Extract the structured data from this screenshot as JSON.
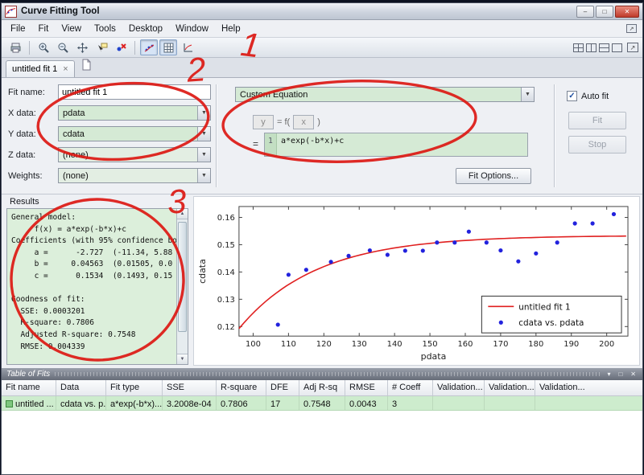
{
  "titlebar": {
    "title": "Curve Fitting Tool"
  },
  "menubar": {
    "items": [
      "File",
      "Fit",
      "View",
      "Tools",
      "Desktop",
      "Window",
      "Help"
    ]
  },
  "tabbar": {
    "tab_label": "untitled fit 1"
  },
  "icons": {
    "minimize": "–",
    "maximize": "□",
    "close": "✕",
    "combo_arrow": "▼",
    "tab_close": "×",
    "check": "✓",
    "scroll_up": "▲",
    "scroll_down": "▼",
    "undock_arrow": "↗",
    "tof_collapse": "▾",
    "tof_restore": "□",
    "tof_close": "✕"
  },
  "fit_panel": {
    "fit_name_label": "Fit name:",
    "fit_name_value": "untitled fit 1",
    "x_label": "X data:",
    "x_value": "pdata",
    "y_label": "Y data:",
    "y_value": "cdata",
    "z_label": "Z data:",
    "z_value": "(none)",
    "w_label": "Weights:",
    "w_value": "(none)"
  },
  "equation_panel": {
    "type_value": "Custom Equation",
    "y_box": "y",
    "equals_f": "=  f(",
    "x_box": "x",
    "close_paren": ")",
    "equals": "=",
    "line_no": "1",
    "equation": "a*exp(-b*x)+c",
    "fit_options_label": "Fit Options..."
  },
  "controls": {
    "auto_fit": "Auto fit",
    "fit": "Fit",
    "stop": "Stop"
  },
  "results": {
    "title": "Results",
    "text": [
      "General model:",
      "     f(x) = a*exp(-b*x)+c",
      "Coefficients (with 95% confidence bou",
      "     a =      -2.727  (-11.34, 5.88",
      "     b =     0.04563  (0.01505, 0.0",
      "     c =      0.1534  (0.1493, 0.15",
      "",
      "Goodness of fit:",
      "  SSE: 0.0003201",
      "  R-square: 0.7806",
      "  Adjusted R-square: 0.7548",
      "  RMSE: 0.004339"
    ]
  },
  "chart_data": {
    "type": "scatter",
    "xlabel": "pdata",
    "ylabel": "cdata",
    "xlim": [
      96,
      206
    ],
    "ylim": [
      0.1165,
      0.164
    ],
    "xticks": [
      100,
      110,
      120,
      130,
      140,
      150,
      160,
      170,
      180,
      190,
      200
    ],
    "yticks": [
      0.12,
      0.13,
      0.14,
      0.15,
      0.16
    ],
    "grid": false,
    "legend_position": "lower right",
    "series": [
      {
        "name": "untitled fit 1",
        "type": "line",
        "color": "#e02020",
        "model": "a*exp(-b*x)+c",
        "coefficients": {
          "a": -2.727,
          "b": 0.04563,
          "c": 0.1534
        }
      },
      {
        "name": "cdata vs. pdata",
        "type": "scatter",
        "color": "#2222dd",
        "points": [
          [
            107,
            0.1207
          ],
          [
            110,
            0.139
          ],
          [
            115,
            0.1408
          ],
          [
            122,
            0.1437
          ],
          [
            127,
            0.1459
          ],
          [
            133,
            0.1479
          ],
          [
            138,
            0.1463
          ],
          [
            143,
            0.1478
          ],
          [
            148,
            0.1478
          ],
          [
            152,
            0.1508
          ],
          [
            157,
            0.1508
          ],
          [
            161,
            0.1548
          ],
          [
            166,
            0.1508
          ],
          [
            170,
            0.1479
          ],
          [
            175,
            0.1439
          ],
          [
            180,
            0.1468
          ],
          [
            186,
            0.1508
          ],
          [
            191,
            0.1578
          ],
          [
            196,
            0.1578
          ],
          [
            202,
            0.1612
          ]
        ]
      }
    ]
  },
  "table_of_fits": {
    "title": "Table of Fits",
    "columns": [
      "Fit name",
      "Data",
      "Fit type",
      "SSE",
      "R-square",
      "DFE",
      "Adj R-sq",
      "RMSE",
      "# Coeff",
      "Validation...",
      "Validation...",
      "Validation..."
    ],
    "row": [
      "untitled ...",
      "cdata vs. p...",
      "a*exp(-b*x)...",
      "3.2008e-04",
      "0.7806",
      "17",
      "0.7548",
      "0.0043",
      "3",
      "",
      "",
      ""
    ]
  },
  "annotations": {
    "labels": [
      "1",
      "2",
      "3"
    ]
  }
}
